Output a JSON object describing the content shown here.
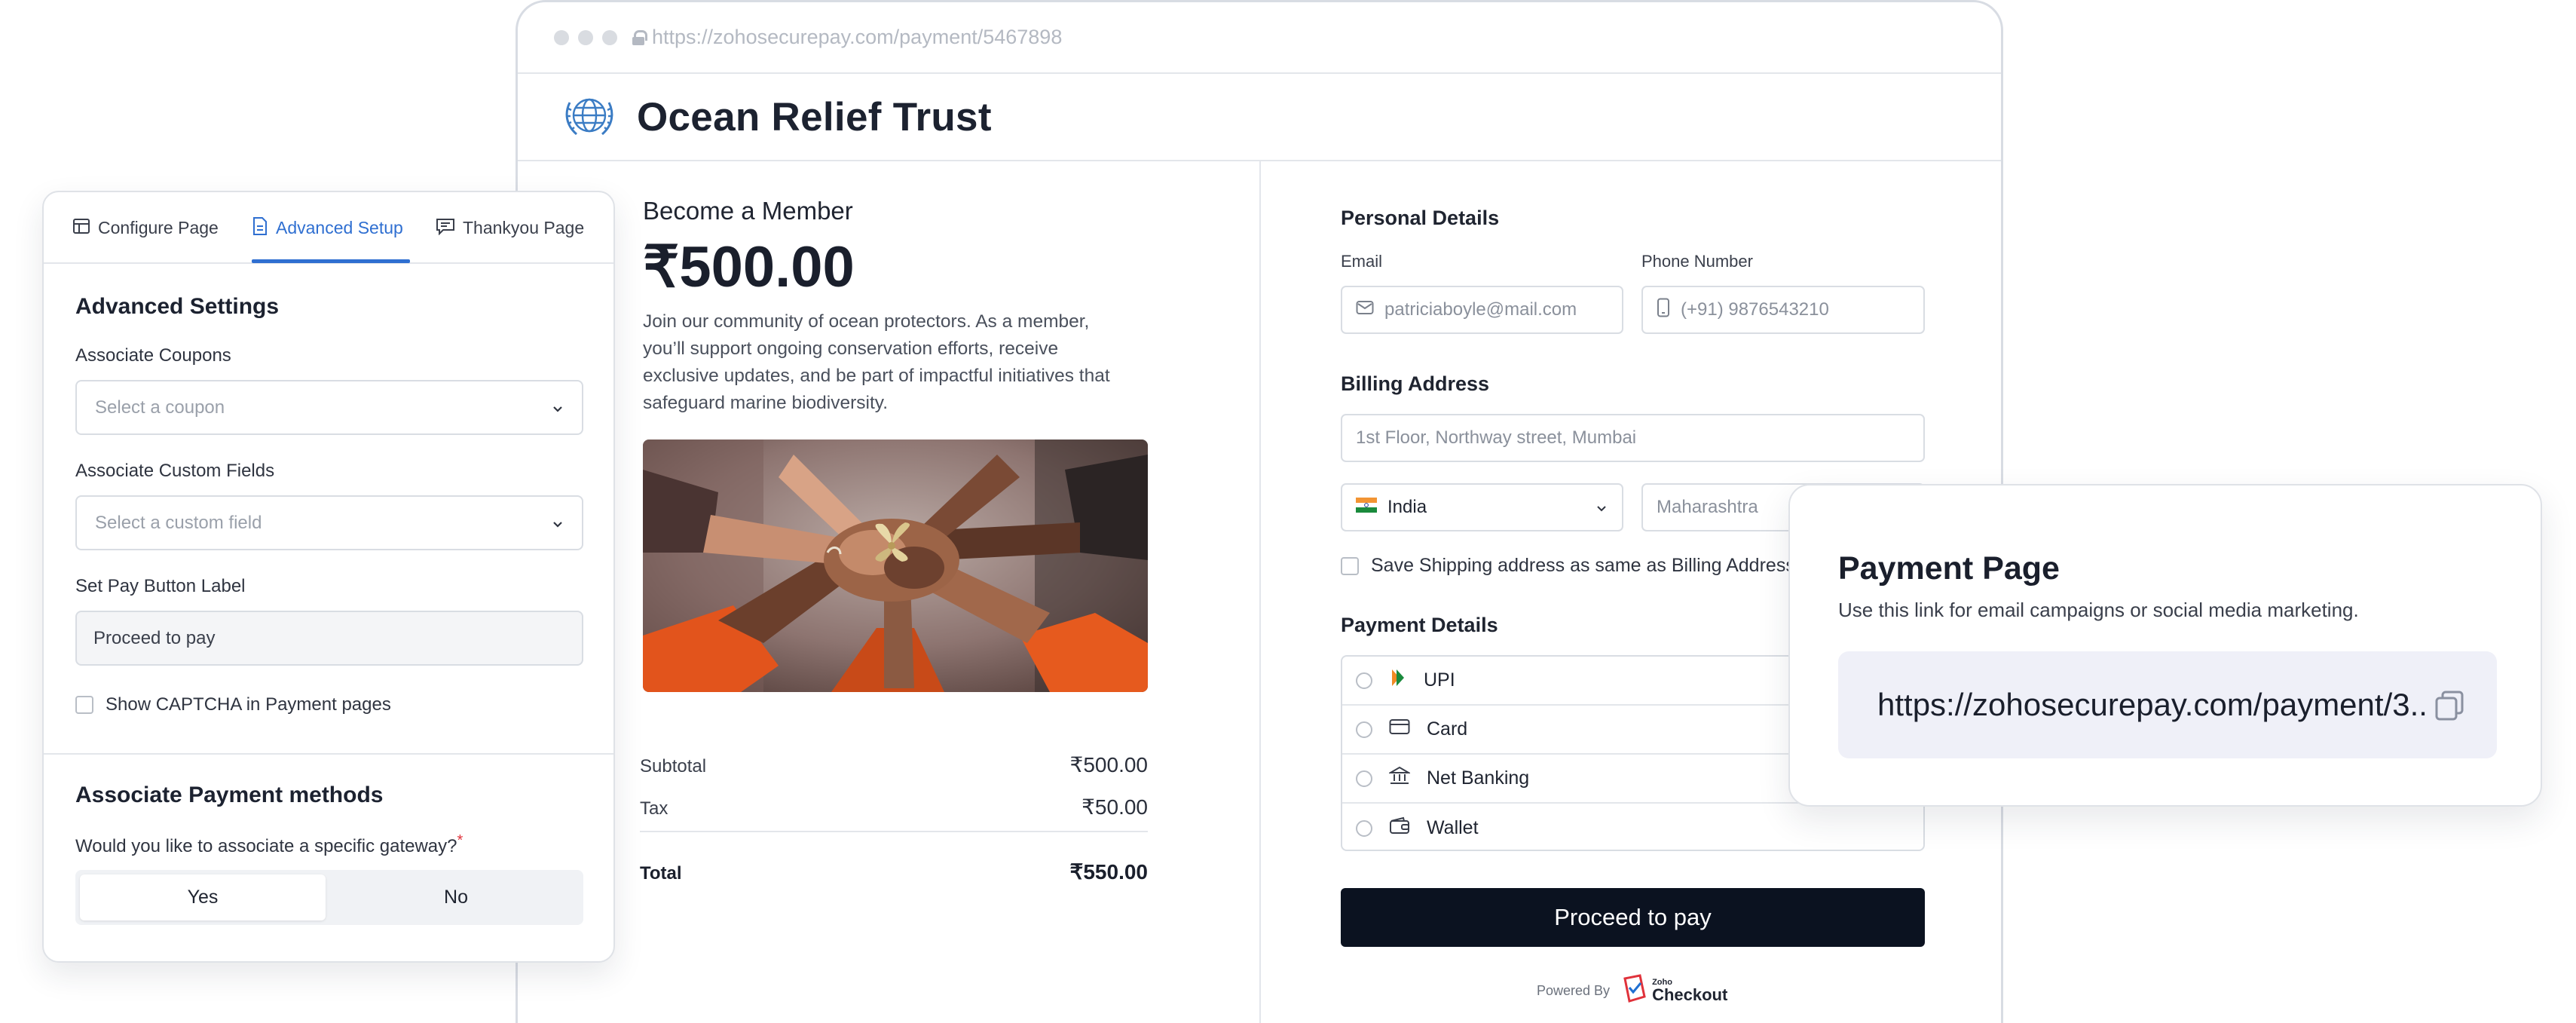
{
  "browser": {
    "url": "https://zohosecurepay.com/payment/5467898"
  },
  "org": {
    "name": "Ocean Relief Trust"
  },
  "summary": {
    "heading": "Become a Member",
    "amount": "₹500.00",
    "description": "Join our community of ocean protectors. As a member, you’ll support ongoing conservation efforts, receive exclusive updates, and be part of impactful initiatives that safeguard marine biodiversity.",
    "subtotal_label": "Subtotal",
    "subtotal_value": "₹500.00",
    "tax_label": "Tax",
    "tax_value": "₹50.00",
    "total_label": "Total",
    "total_value": "₹550.00"
  },
  "form": {
    "personal_title": "Personal Details",
    "email_label": "Email",
    "email_value": "patriciaboyle@mail.com",
    "phone_label": "Phone Number",
    "phone_value": "(+91) 9876543210",
    "billing_title": "Billing Address",
    "address_value": "1st Floor, Northway street, Mumbai",
    "country_value": "India",
    "state_value": "Maharashtra",
    "shipping_same_label": "Save Shipping address as same as Billing Address",
    "payment_title": "Payment Details",
    "methods": [
      "UPI",
      "Card",
      "Net Banking",
      "Wallet"
    ],
    "pay_button": "Proceed to pay",
    "powered_by": "Powered By",
    "brand_small": "Zoho",
    "brand_large": "Checkout"
  },
  "settings_panel": {
    "tabs": [
      "Configure Page",
      "Advanced Setup",
      "Thankyou Page"
    ],
    "active_tab": "Advanced Setup",
    "title": "Advanced Settings",
    "coupons_label": "Associate Coupons",
    "coupons_placeholder": "Select a coupon",
    "custom_fields_label": "Associate Custom Fields",
    "custom_fields_placeholder": "Select a custom field",
    "pay_label_label": "Set Pay Button Label",
    "pay_label_value": "Proceed to pay",
    "captcha_label": "Show CAPTCHA in Payment pages",
    "methods_title": "Associate Payment methods",
    "gateway_question": "Would you like to associate a specific gateway?",
    "required_mark": "*",
    "yes": "Yes",
    "no": "No",
    "selected": "Yes"
  },
  "link_card": {
    "title": "Payment Page",
    "subtitle": "Use this link for email campaigns or social media marketing.",
    "link": "https://zohosecurepay.com/payment/3.."
  },
  "colors": {
    "accent": "#2f6fd1",
    "pay_button": "#0b1220",
    "required": "#e0323b",
    "link_box": "#eff0f8"
  },
  "icons": {
    "org_logo": "globe-icon",
    "email": "mail-icon",
    "phone": "phone-icon",
    "flag": "india-flag-icon",
    "upi": "upi-icon",
    "card": "card-icon",
    "net_banking": "bank-icon",
    "wallet": "wallet-icon",
    "copy": "copy-icon"
  }
}
